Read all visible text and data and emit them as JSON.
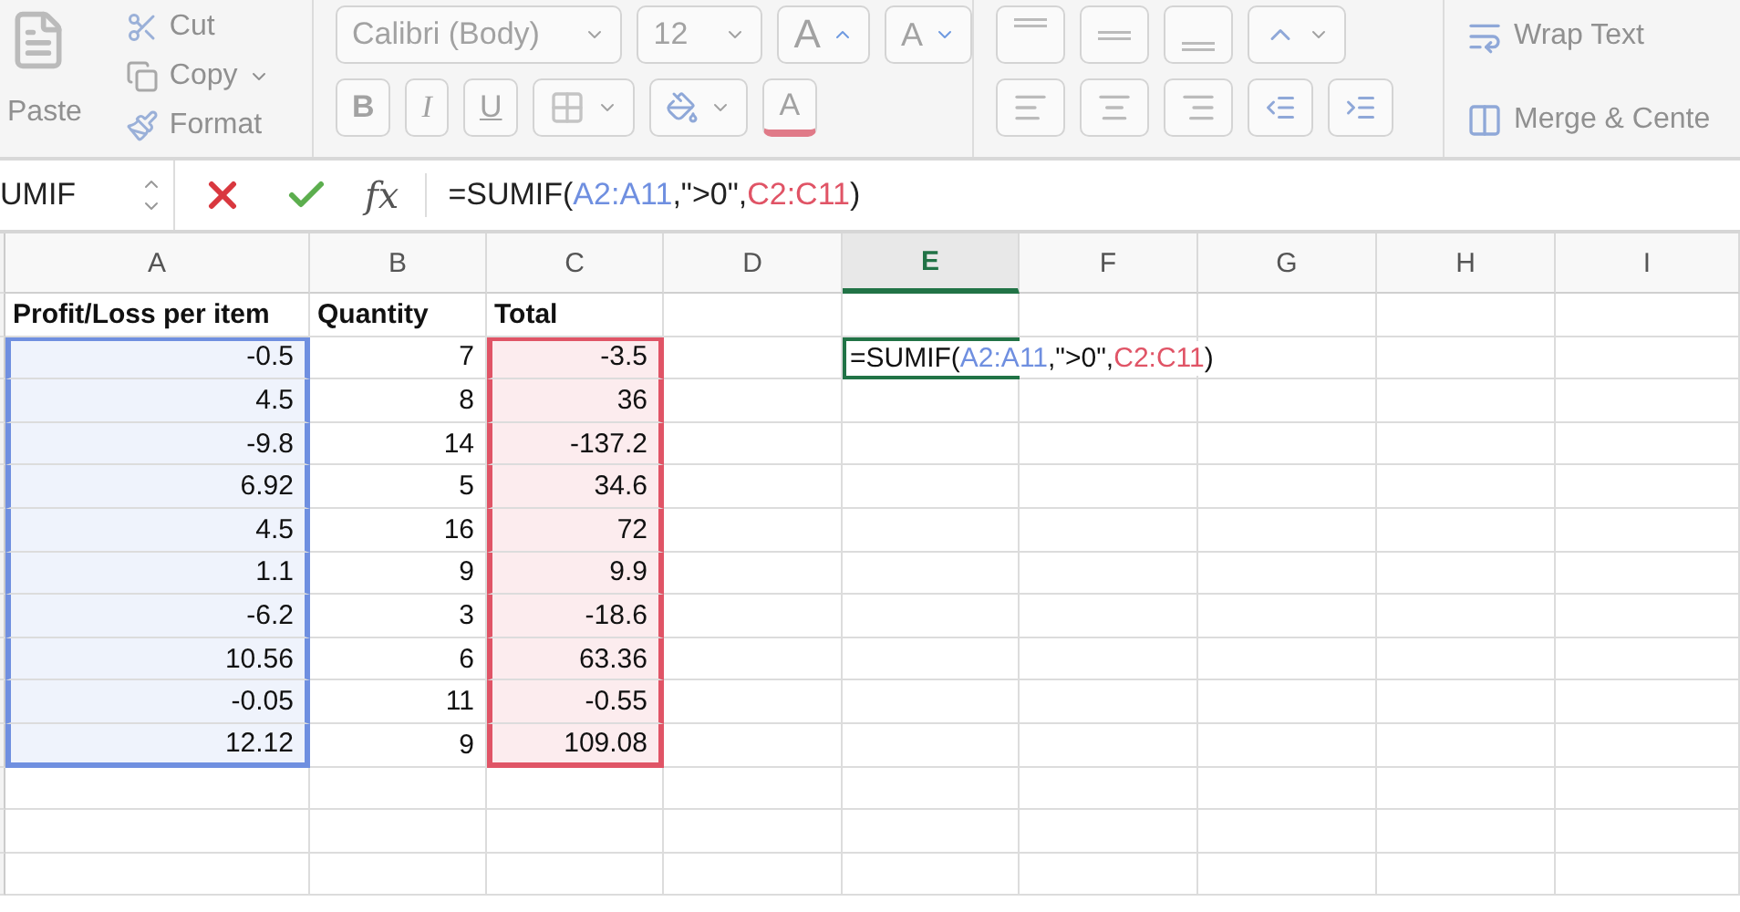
{
  "ribbon": {
    "disabled": true,
    "clipboard": {
      "paste": "Paste",
      "cut": "Cut",
      "copy": "Copy",
      "format": "Format"
    },
    "font": {
      "name": "Calibri (Body)",
      "size": "12",
      "grow": "A",
      "shrink": "A",
      "bold": "B",
      "italic": "I",
      "underline": "U",
      "font_color": "A"
    },
    "wrap_text": "Wrap Text",
    "merge": "Merge & Cente"
  },
  "formula_bar": {
    "name_box": "UMIF",
    "fx": "fx",
    "formula": [
      {
        "text": "=SUMIF("
      },
      {
        "text": "A2:A11",
        "color": "#6f8fe0"
      },
      {
        "text": ",\">0\","
      },
      {
        "text": "C2:C11",
        "color": "#e05466"
      },
      {
        "text": ")"
      }
    ]
  },
  "sheet": {
    "columns": [
      {
        "label": "A",
        "selected": false,
        "color": "#6f8fe0"
      },
      {
        "label": "B",
        "selected": false
      },
      {
        "label": "C",
        "selected": false,
        "color": "#e05466"
      },
      {
        "label": "D",
        "selected": false
      },
      {
        "label": "E",
        "selected": true
      },
      {
        "label": "F",
        "selected": false
      },
      {
        "label": "G",
        "selected": false
      },
      {
        "label": "H",
        "selected": false
      },
      {
        "label": "I",
        "selected": false
      }
    ],
    "rows": [
      {
        "kind": "header",
        "cells": [
          "Profit/Loss per item",
          "Quantity",
          "Total",
          "",
          "",
          "",
          "",
          "",
          ""
        ]
      },
      {
        "kind": "data",
        "cells": [
          "-0.5",
          "7",
          "-3.5",
          "",
          "",
          "",
          "",
          "",
          ""
        ],
        "active_cell": {
          "formula": [
            {
              "text": "=SUMIF("
            },
            {
              "text": "A2:A11",
              "color": "#6f8fe0"
            },
            {
              "text": ",\">0\","
            },
            {
              "text": "C2:C11",
              "color": "#e05466"
            },
            {
              "text": ")"
            }
          ]
        }
      },
      {
        "kind": "data",
        "cells": [
          "4.5",
          "8",
          "36",
          "",
          "",
          "",
          "",
          "",
          ""
        ]
      },
      {
        "kind": "data",
        "cells": [
          "-9.8",
          "14",
          "-137.2",
          "",
          "",
          "",
          "",
          "",
          ""
        ]
      },
      {
        "kind": "data",
        "cells": [
          "6.92",
          "5",
          "34.6",
          "",
          "",
          "",
          "",
          "",
          ""
        ]
      },
      {
        "kind": "data",
        "cells": [
          "4.5",
          "16",
          "72",
          "",
          "",
          "",
          "",
          "",
          ""
        ]
      },
      {
        "kind": "data",
        "cells": [
          "1.1",
          "9",
          "9.9",
          "",
          "",
          "",
          "",
          "",
          ""
        ]
      },
      {
        "kind": "data",
        "cells": [
          "-6.2",
          "3",
          "-18.6",
          "",
          "",
          "",
          "",
          "",
          ""
        ]
      },
      {
        "kind": "data",
        "cells": [
          "10.56",
          "6",
          "63.36",
          "",
          "",
          "",
          "",
          "",
          ""
        ]
      },
      {
        "kind": "data",
        "cells": [
          "-0.05",
          "11",
          "-0.55",
          "",
          "",
          "",
          "",
          "",
          ""
        ]
      },
      {
        "kind": "data",
        "cells": [
          "12.12",
          "9",
          "109.08",
          "",
          "",
          "",
          "",
          "",
          ""
        ]
      }
    ]
  }
}
